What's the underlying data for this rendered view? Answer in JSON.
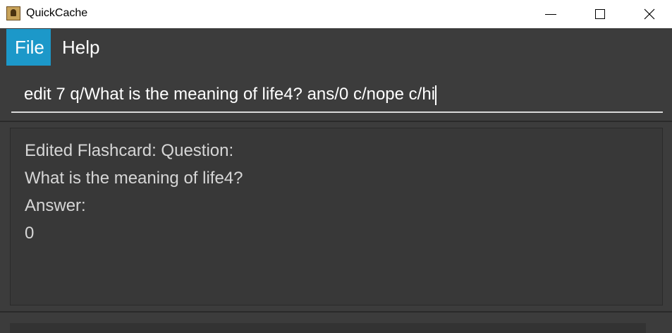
{
  "window": {
    "title": "QuickCache",
    "app_icon": "quickcache-icon",
    "controls": [
      "minimize-icon",
      "maximize-icon",
      "close-icon"
    ]
  },
  "menu": {
    "items": [
      {
        "label": "File",
        "active": true
      },
      {
        "label": "Help",
        "active": false
      }
    ]
  },
  "command": {
    "value": "edit 7 q/What is the meaning of life4? ans/0 c/nope c/hi"
  },
  "result": {
    "lines": [
      "Edited Flashcard: Question:",
      "What is the meaning of life4?",
      "Answer:",
      "0"
    ]
  },
  "colors": {
    "accent": "#1c98c9",
    "background": "#3c3c3c",
    "panel": "#383838",
    "text": "#ffffff",
    "result_text": "#d6d6d6"
  }
}
